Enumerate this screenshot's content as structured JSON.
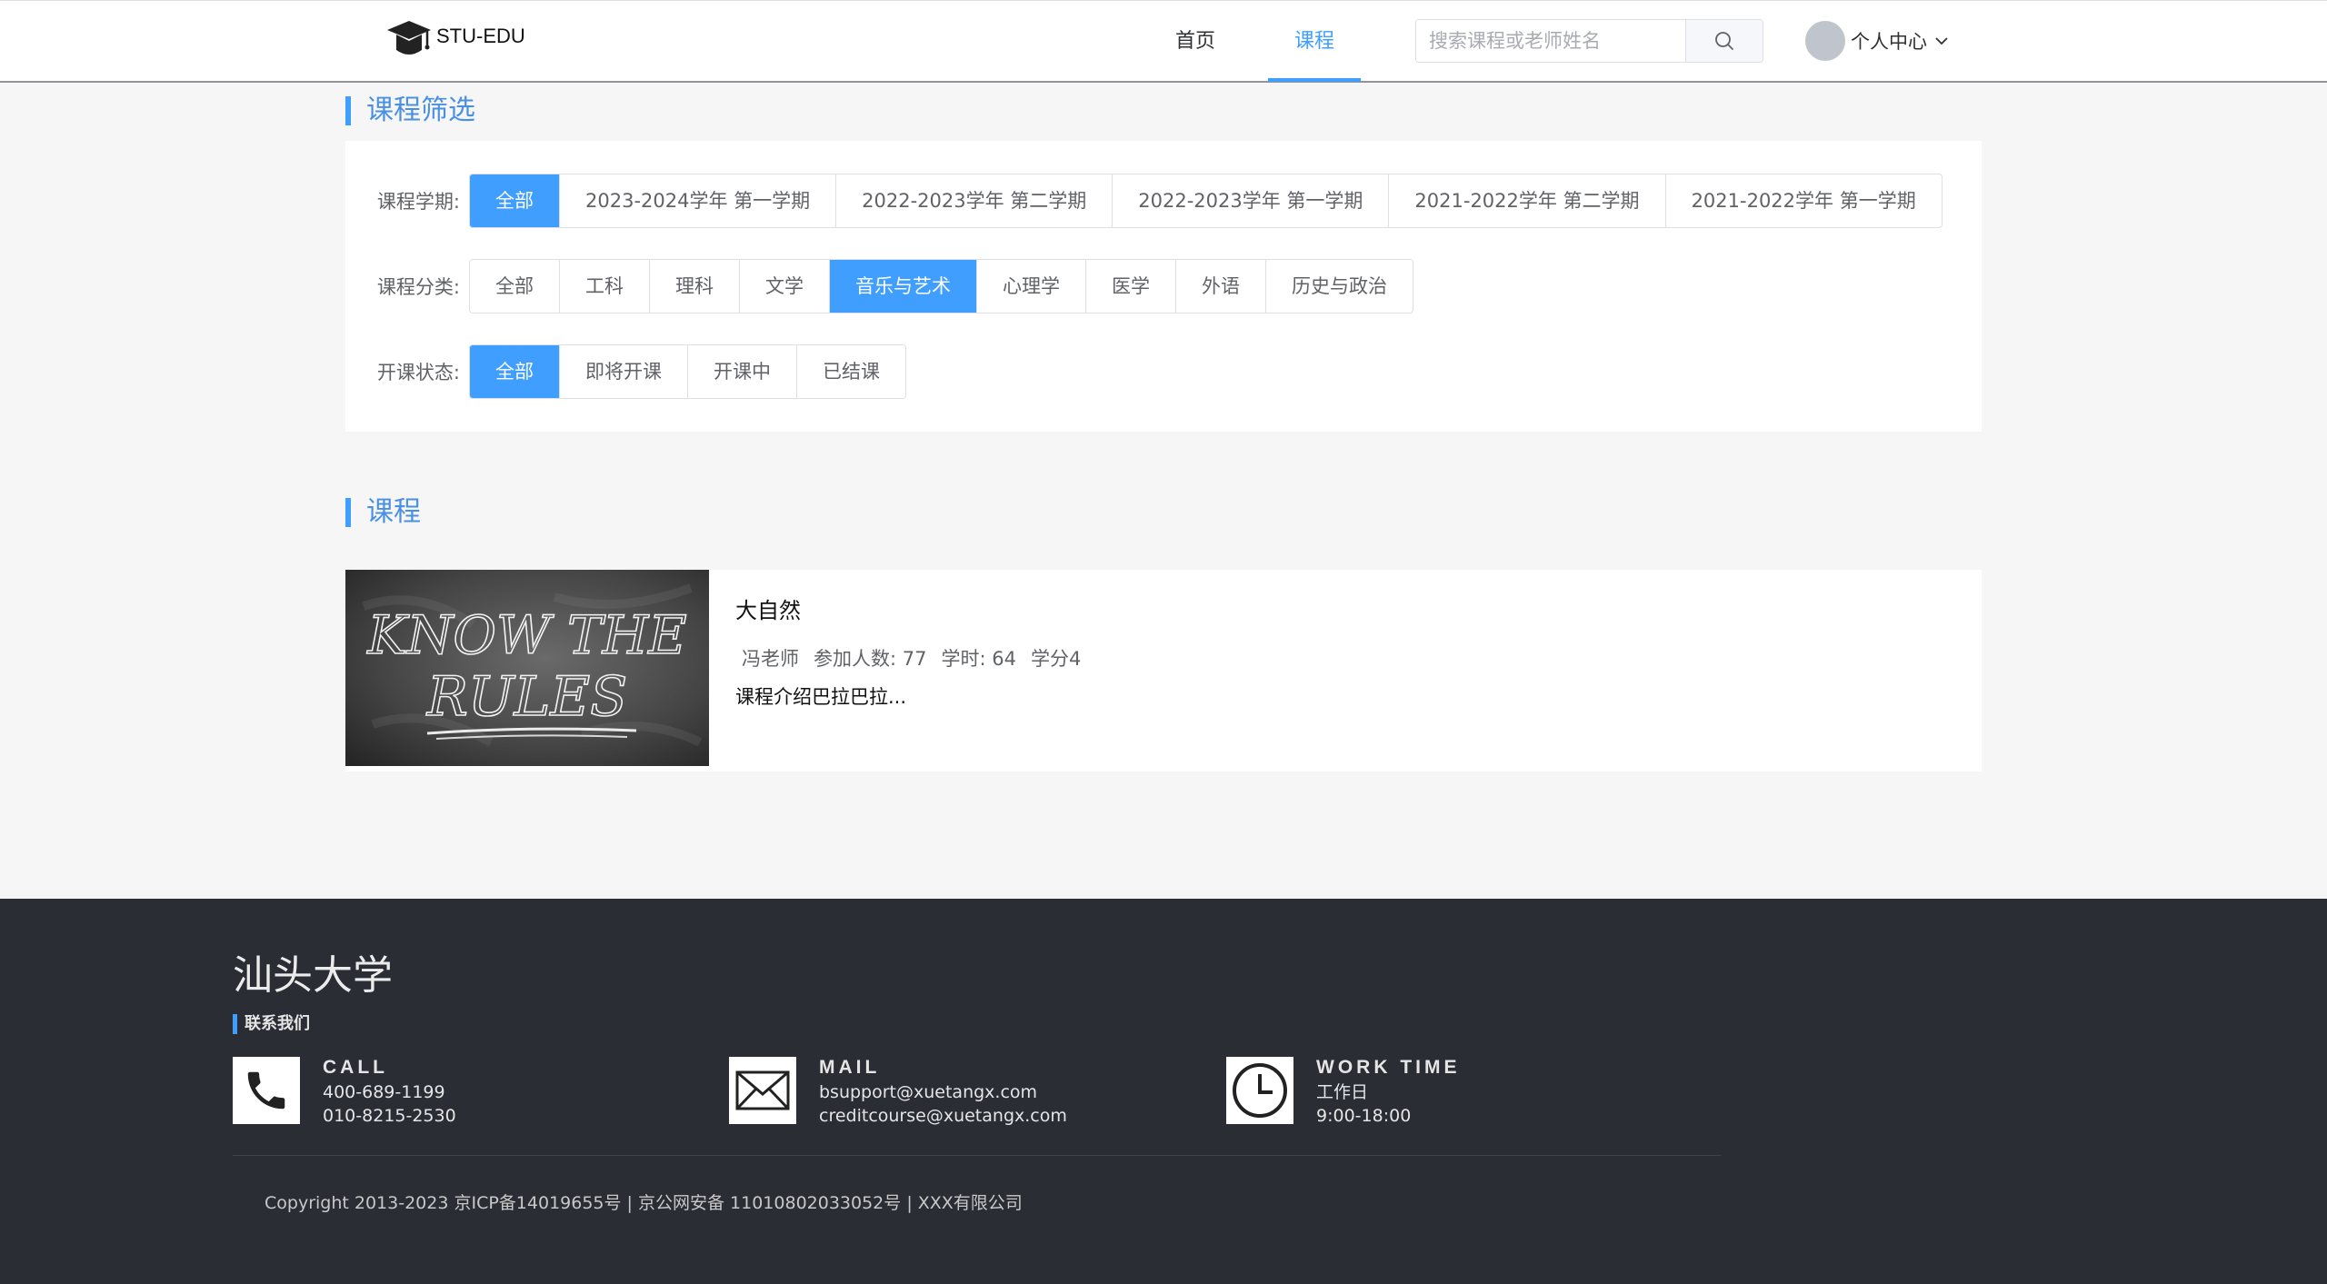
{
  "header": {
    "logo_text": "STU-EDU",
    "nav": {
      "home": "首页",
      "course": "课程"
    },
    "search_placeholder": "搜索课程或老师姓名",
    "user_center": "个人中心"
  },
  "filters": {
    "section_title": "课程筛选",
    "term": {
      "label": "课程学期:",
      "options": [
        "全部",
        "2023-2024学年 第一学期",
        "2022-2023学年 第二学期",
        "2022-2023学年 第一学期",
        "2021-2022学年 第二学期",
        "2021-2022学年 第一学期"
      ],
      "selected": "全部"
    },
    "category": {
      "label": "课程分类:",
      "options": [
        "全部",
        "工科",
        "理科",
        "文学",
        "音乐与艺术",
        "心理学",
        "医学",
        "外语",
        "历史与政治"
      ],
      "selected": "音乐与艺术"
    },
    "status": {
      "label": "开课状态:",
      "options": [
        "全部",
        "即将开课",
        "开课中",
        "已结课"
      ],
      "selected": "全部"
    }
  },
  "courses": {
    "section_title": "课程",
    "items": [
      {
        "thumbnail_text_line1": "KNOW THE",
        "thumbnail_text_line2": "RULES",
        "name": "大自然",
        "teacher": "冯老师",
        "participants": "参加人数: 77",
        "hours": "学时: 64",
        "credits": "学分4",
        "description": "课程介绍巴拉巴拉..."
      }
    ]
  },
  "footer": {
    "school_name": "汕头大学",
    "contact_title": "联系我们",
    "call": {
      "heading": "CALL",
      "lines": [
        "400-689-1199",
        "010-8215-2530"
      ]
    },
    "mail": {
      "heading": "MAIL",
      "lines": [
        "bsupport@xuetangx.com",
        "creditcourse@xuetangx.com"
      ]
    },
    "work_time": {
      "heading": "WORK TIME",
      "lines": [
        "工作日",
        "9:00-18:00"
      ]
    },
    "copyright": "Copyright 2013-2023 京ICP备14019655号 | 京公网安备 11010802033052号 | XXX有限公司"
  },
  "colors": {
    "accent": "#409eff",
    "footer_bg": "#2b2d35",
    "page_bg": "#f6f6f6"
  }
}
